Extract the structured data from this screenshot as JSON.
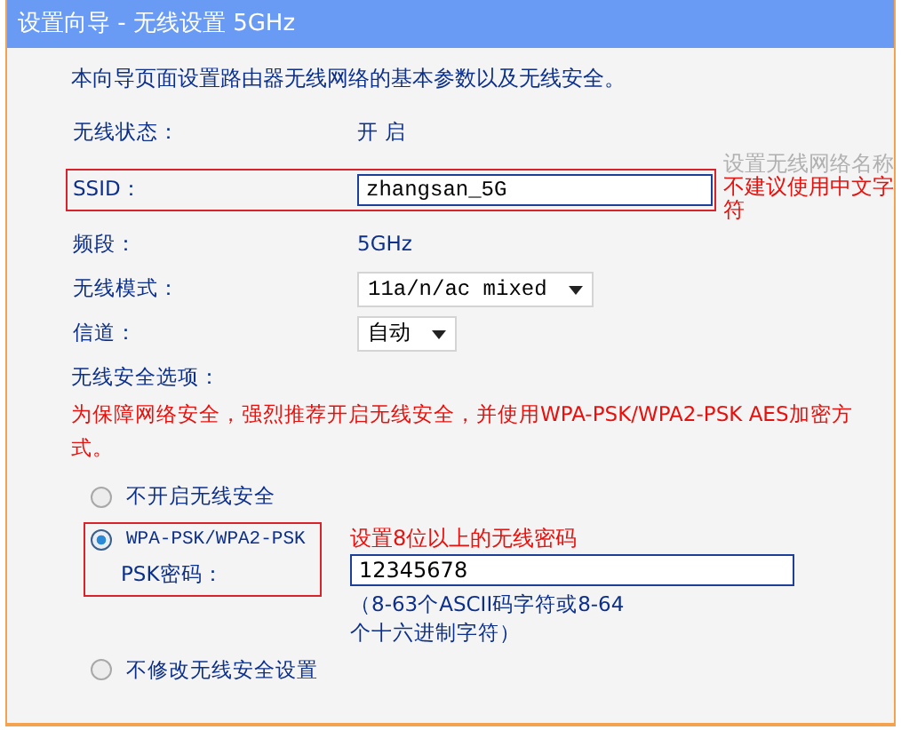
{
  "window": {
    "title": "设置向导 - 无线设置 5GHz"
  },
  "intro": "本向导页面设置路由器无线网络的基本参数以及无线安全。",
  "fields": [
    {
      "kind": "text",
      "label": "无线状态：",
      "value": "开 启"
    },
    {
      "kind": "input",
      "label": "SSID：",
      "value": "zhangsan_5G",
      "highlighted": true,
      "hint": "设置无线网络名称",
      "note": "不建议使用中文字符"
    },
    {
      "kind": "text",
      "label": "频段：",
      "value": "5GHz"
    },
    {
      "kind": "select",
      "label": "无线模式：",
      "value": "11a/n/ac mixed"
    },
    {
      "kind": "select",
      "label": "信道：",
      "value": "自动"
    }
  ],
  "security": {
    "label": "无线安全选项：",
    "warning": "为保障网络安全，强烈推荐开启无线安全，并使用WPA-PSK/WPA2-PSK AES加密方式。",
    "options": [
      {
        "label": "不开启无线安全",
        "selected": false
      },
      {
        "label": "WPA-PSK/WPA2-PSK",
        "selected": true,
        "highlighted": true,
        "password_label": "PSK密码：",
        "password_note": "设置8位以上的无线密码",
        "password": "12345678",
        "help": "（8-63个ASCII码字符或8-64个十六进制字符）"
      },
      {
        "label": "不修改无线安全设置",
        "selected": false
      }
    ]
  }
}
